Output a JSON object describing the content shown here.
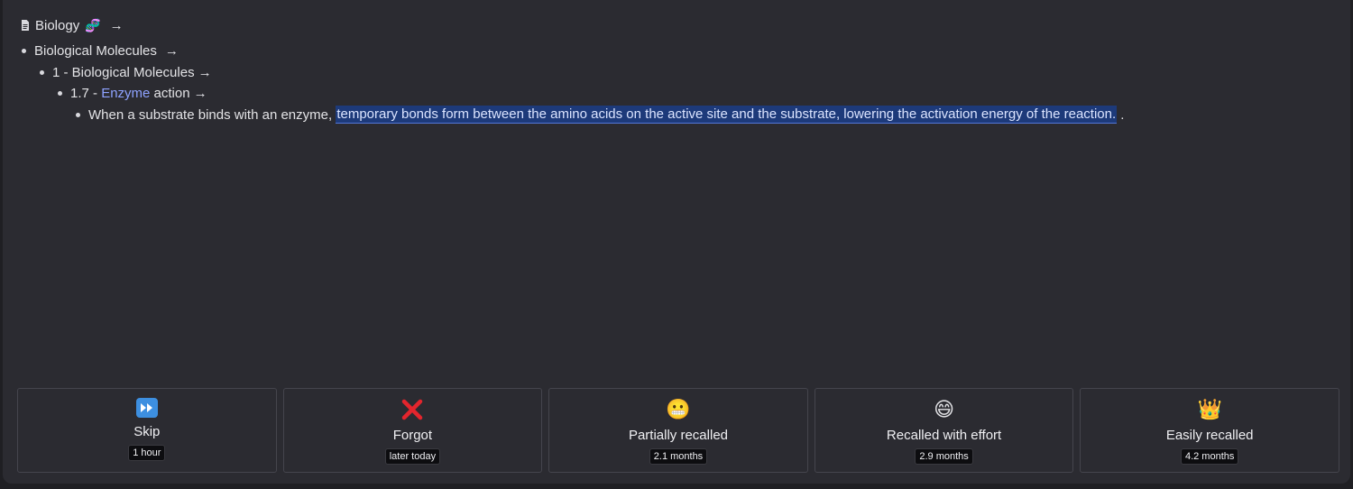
{
  "breadcrumb": {
    "title": "Biology",
    "title_emoji": "🧬",
    "arrow": "→"
  },
  "outline": {
    "level1": {
      "text": "Biological Molecules",
      "arrow": "→"
    },
    "level2": {
      "text": "1 - Biological Molecules",
      "arrow": "→"
    },
    "level3": {
      "prefix": "1.7 - ",
      "link": "Enzyme",
      "suffix": " action",
      "arrow": "→"
    },
    "level4": {
      "text_before": "When a substrate binds with an enzyme, ",
      "highlighted": "temporary bonds form between the amino acids on the active site and the substrate, lowering the activation energy of the reaction.",
      "text_after": " ."
    }
  },
  "ratings": [
    {
      "icon": "fast-forward-icon",
      "emoji": "⏩",
      "label": "Skip",
      "interval": "1 hour"
    },
    {
      "icon": "cross-mark-icon",
      "emoji": "❌",
      "label": "Forgot",
      "interval": "later today"
    },
    {
      "icon": "grimace-icon",
      "emoji": "😬",
      "label": "Partially recalled",
      "interval": "2.1 months"
    },
    {
      "icon": "grin-icon",
      "emoji": "😄",
      "label": "Recalled with effort",
      "interval": "2.9 months"
    },
    {
      "icon": "crown-icon",
      "emoji": "👑",
      "label": "Easily recalled",
      "interval": "4.2 months"
    }
  ],
  "colors": {
    "background": "#2b2b31",
    "link": "#8ea2ff",
    "highlight": "#1d3a7a"
  }
}
